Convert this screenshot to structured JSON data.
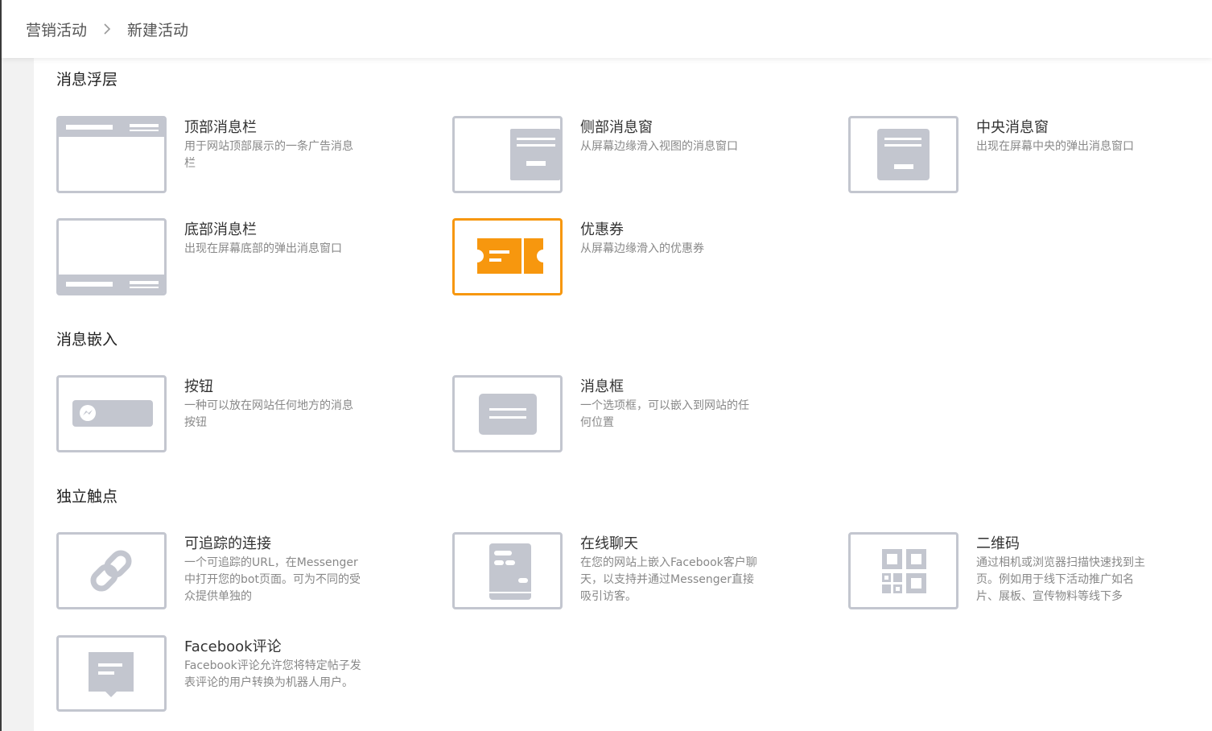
{
  "breadcrumb": {
    "parent": "营销活动",
    "current": "新建活动"
  },
  "sections": {
    "overlay": {
      "title": "消息浮层"
    },
    "embed": {
      "title": "消息嵌入"
    },
    "standalone": {
      "title": "独立触点"
    }
  },
  "cards": {
    "top_bar": {
      "title": "顶部消息栏",
      "desc": "用于网站顶部展示的一条广告消息栏"
    },
    "side_window": {
      "title": "侧部消息窗",
      "desc": "从屏幕边缘滑入视图的消息窗口"
    },
    "center_window": {
      "title": "中央消息窗",
      "desc": "出现在屏幕中央的弹出消息窗口"
    },
    "bottom_bar": {
      "title": "底部消息栏",
      "desc": "出现在屏幕底部的弹出消息窗口"
    },
    "coupon": {
      "title": "优惠券",
      "desc": "从屏幕边缘滑入的优惠券",
      "selected": true
    },
    "button": {
      "title": "按钮",
      "desc": "一种可以放在网站任何地方的消息按钮"
    },
    "message_box": {
      "title": "消息框",
      "desc": "一个选项框，可以嵌入到网站的任何位置"
    },
    "tracked_link": {
      "title": "可追踪的连接",
      "desc": "一个可追踪的URL，在Messenger中打开您的bot页面。可为不同的受众提供单独的"
    },
    "live_chat": {
      "title": "在线聊天",
      "desc": "在您的网站上嵌入Facebook客户聊天，以支持并通过Messenger直接吸引访客。"
    },
    "qr_code": {
      "title": "二维码",
      "desc": "通过相机或浏览器扫描快速找到主页。例如用于线下活动推广如名片、展板、宣传物料等线下多"
    },
    "fb_comment": {
      "title": "Facebook评论",
      "desc": "Facebook评论允许您将特定帖子发表评论的用户转换为机器人用户。"
    }
  },
  "colors": {
    "icon_gray": "#c3c6cf",
    "accent_orange": "#f7970e",
    "bar_white": "#ffffff"
  },
  "icons": [
    "chevron-right-icon",
    "top-bar-icon",
    "side-window-icon",
    "center-window-icon",
    "bottom-bar-icon",
    "coupon-icon",
    "messenger-button-icon",
    "message-box-icon",
    "link-icon",
    "chat-icon",
    "qr-code-icon",
    "comment-icon"
  ]
}
